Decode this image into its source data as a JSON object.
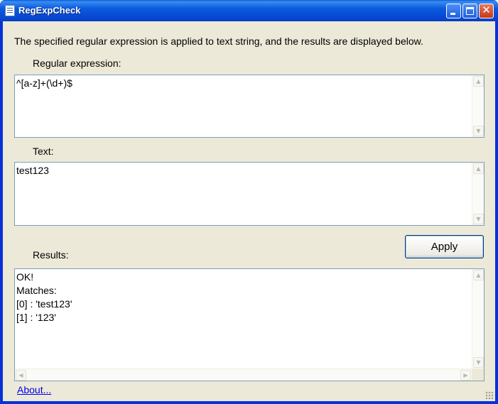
{
  "window": {
    "title": "RegExpCheck",
    "icons": {
      "app": "regexp-app-icon",
      "minimize": "minimize-icon",
      "maximize": "maximize-icon",
      "close": "close-icon"
    }
  },
  "description": "The specified regular expression is applied to text string, and the results are displayed below.",
  "regex": {
    "label": "Regular expression:",
    "value": "^[a-z]+(\\d+)$"
  },
  "text": {
    "label": "Text:",
    "value": "test123"
  },
  "apply_label": "Apply",
  "results": {
    "label": "Results:",
    "value": "OK!\nMatches:\n[0] : 'test123'\n[1] : '123'"
  },
  "about_label": "About...",
  "colors": {
    "title_bar": "#0b5ae0",
    "client_background": "#ece9d8",
    "textbox_border": "#7f9db9",
    "link": "#0000ee"
  }
}
